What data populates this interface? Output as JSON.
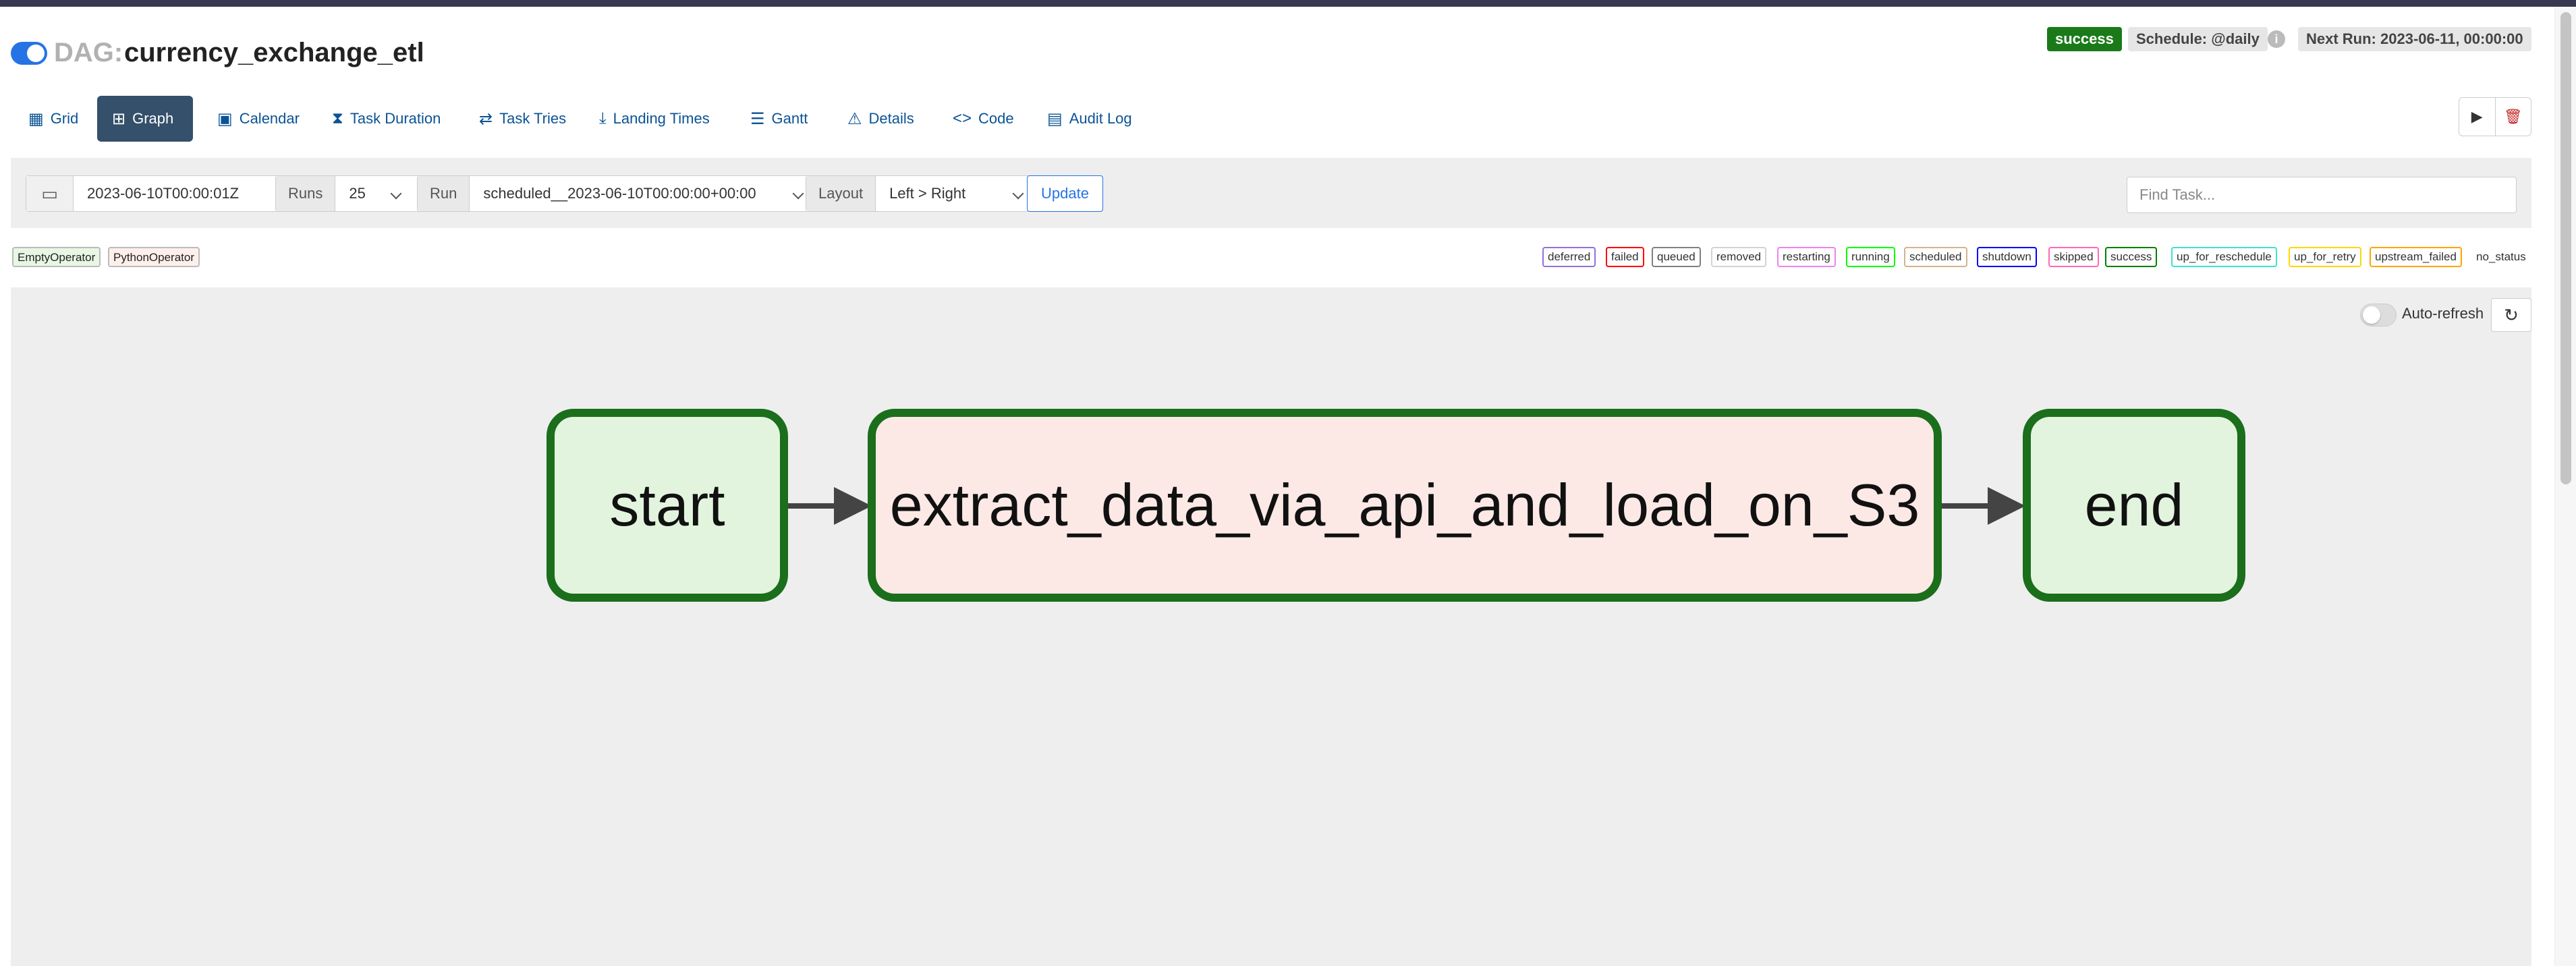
{
  "header": {
    "dag_prefix": "DAG:",
    "dag_name": "currency_exchange_etl",
    "state": "success",
    "schedule": "Schedule: @daily",
    "next_run": "Next Run: 2023-06-11, 00:00:00",
    "toggle_on": true
  },
  "tabs": [
    {
      "label": "Grid",
      "icon": "grid-icon",
      "active": false
    },
    {
      "label": "Graph",
      "icon": "graph-icon",
      "active": true
    },
    {
      "label": "Calendar",
      "icon": "calendar-icon",
      "active": false
    },
    {
      "label": "Task Duration",
      "icon": "hourglass-icon",
      "active": false
    },
    {
      "label": "Task Tries",
      "icon": "retry-icon",
      "active": false
    },
    {
      "label": "Landing Times",
      "icon": "landing-icon",
      "active": false
    },
    {
      "label": "Gantt",
      "icon": "gantt-icon",
      "active": false
    },
    {
      "label": "Details",
      "icon": "warning-triangle-icon",
      "active": false
    },
    {
      "label": "Code",
      "icon": "code-icon",
      "active": false
    },
    {
      "label": "Audit Log",
      "icon": "audit-log-icon",
      "active": false
    }
  ],
  "filters": {
    "date": "2023-06-10T00:00:01Z",
    "runs_label": "Runs",
    "runs_value": "25",
    "run_label": "Run",
    "run_value": "scheduled__2023-06-10T00:00:00+00:00",
    "layout_label": "Layout",
    "layout_value": "Left > Right",
    "update_label": "Update",
    "find_placeholder": "Find Task..."
  },
  "operators": [
    {
      "name": "EmptyOperator",
      "color": "#e8f7e4"
    },
    {
      "name": "PythonOperator",
      "color": "#ffefeb"
    }
  ],
  "states": [
    {
      "name": "deferred",
      "color": "#9370db"
    },
    {
      "name": "failed",
      "color": "#ff0000"
    },
    {
      "name": "queued",
      "color": "#808080"
    },
    {
      "name": "removed",
      "color": "#d3d3d3"
    },
    {
      "name": "restarting",
      "color": "#ee82ee"
    },
    {
      "name": "running",
      "color": "#00ff00"
    },
    {
      "name": "scheduled",
      "color": "#d2b48c"
    },
    {
      "name": "shutdown",
      "color": "#0000ff"
    },
    {
      "name": "skipped",
      "color": "#ff69b4"
    },
    {
      "name": "success",
      "color": "#008000"
    },
    {
      "name": "up_for_reschedule",
      "color": "#40e0d0"
    },
    {
      "name": "up_for_retry",
      "color": "#ffd700"
    },
    {
      "name": "upstream_failed",
      "color": "#ffa500"
    }
  ],
  "no_status_label": "no_status",
  "canvas": {
    "autorefresh_label": "Auto-refresh",
    "autorefresh_on": false
  },
  "graph": {
    "nodes": [
      {
        "id": "start",
        "label": "start",
        "operator": "EmptyOperator",
        "state": "success"
      },
      {
        "id": "extract_data_via_api_and_load_on_S3",
        "label": "extract_data_via_api_and_load_on_S3",
        "operator": "PythonOperator",
        "state": "success"
      },
      {
        "id": "end",
        "label": "end",
        "operator": "EmptyOperator",
        "state": "success"
      }
    ],
    "edges": [
      {
        "from": "start",
        "to": "extract_data_via_api_and_load_on_S3"
      },
      {
        "from": "extract_data_via_api_and_load_on_S3",
        "to": "end"
      }
    ]
  },
  "colors": {
    "brand_dark": "#383850",
    "active_tab": "#34506a",
    "link": "#0b5394",
    "success": "#1b6e1b"
  }
}
